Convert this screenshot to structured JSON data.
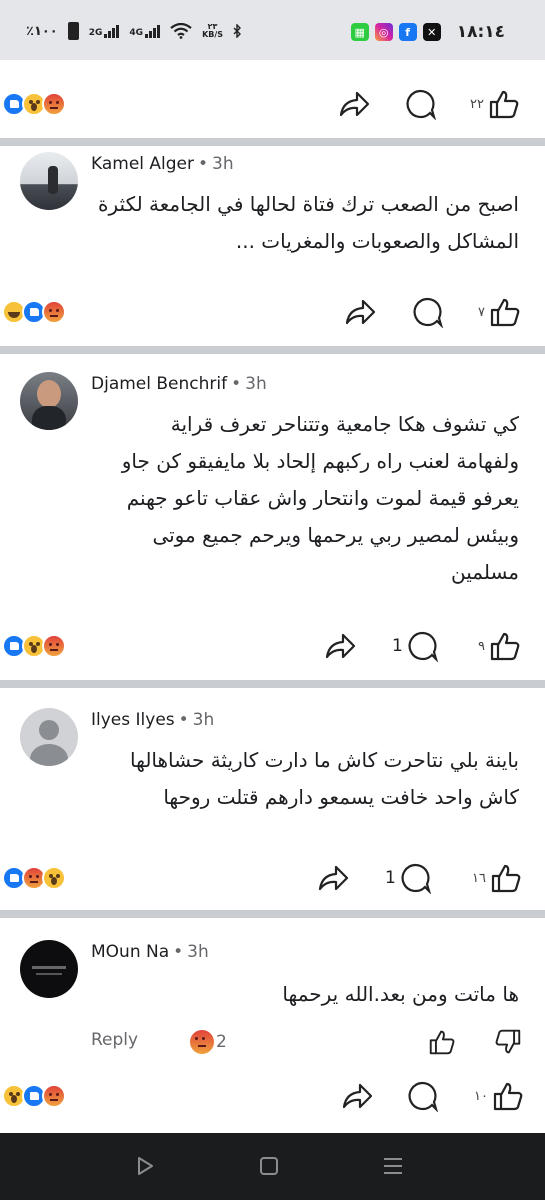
{
  "status_bar": {
    "time": "١٨:١٤",
    "battery": "٪١٠٠",
    "network1": "2G",
    "network2": "4G",
    "speed_value": "٢٣",
    "speed_unit": "KB/S",
    "app_icons": [
      "grid-app-icon",
      "instagram-icon",
      "facebook-icon",
      "x-icon"
    ]
  },
  "top_actions": {
    "like_count": "٢٢"
  },
  "comments": [
    {
      "author": "Kamel Alger",
      "time": "3h",
      "lines": [
        "اصبح من الصعب ترك فتاة لحالها في الجامعة لكثرة",
        "المشاكل والصعوبات والمغريات ..."
      ],
      "like_count": "٧",
      "comment_count": ""
    },
    {
      "author": "Djamel Benchrif",
      "time": "3h",
      "lines": [
        "كي تشوف هكا جامعية وتتناحر تعرف قراية",
        "ولفهامة لعنب راه ركبهم إلحاد بلا مايفيقو كن جاو",
        "يعرفو قيمة لموت وانتحار واش عقاب تاعو جهنم",
        "وبيئس لمصير ربي يرحمها ويرحم جميع موتى",
        "مسلمين"
      ],
      "like_count": "٩",
      "comment_count": "1"
    },
    {
      "author": "Ilyes Ilyes",
      "time": "3h",
      "lines": [
        "باينة بلي نتاحرت كاش ما دارت كاريثة حشاهالها",
        "كاش واحد خافت يسمعو دارهم قتلت روحها"
      ],
      "like_count": "١٦",
      "comment_count": "1"
    },
    {
      "author": "MOun Na",
      "time": "3h",
      "lines": [
        "ها ماتت ومن بعد.الله يرحمها"
      ],
      "reply_label": "Reply",
      "reply_reaction_count": "2",
      "like_count": "١٠",
      "comment_count": ""
    }
  ],
  "colors": {
    "like_blue": "#1877f2",
    "separator": "#c9ccd1",
    "secondary_text": "#65676b",
    "navbar": "#1b1c1e"
  }
}
